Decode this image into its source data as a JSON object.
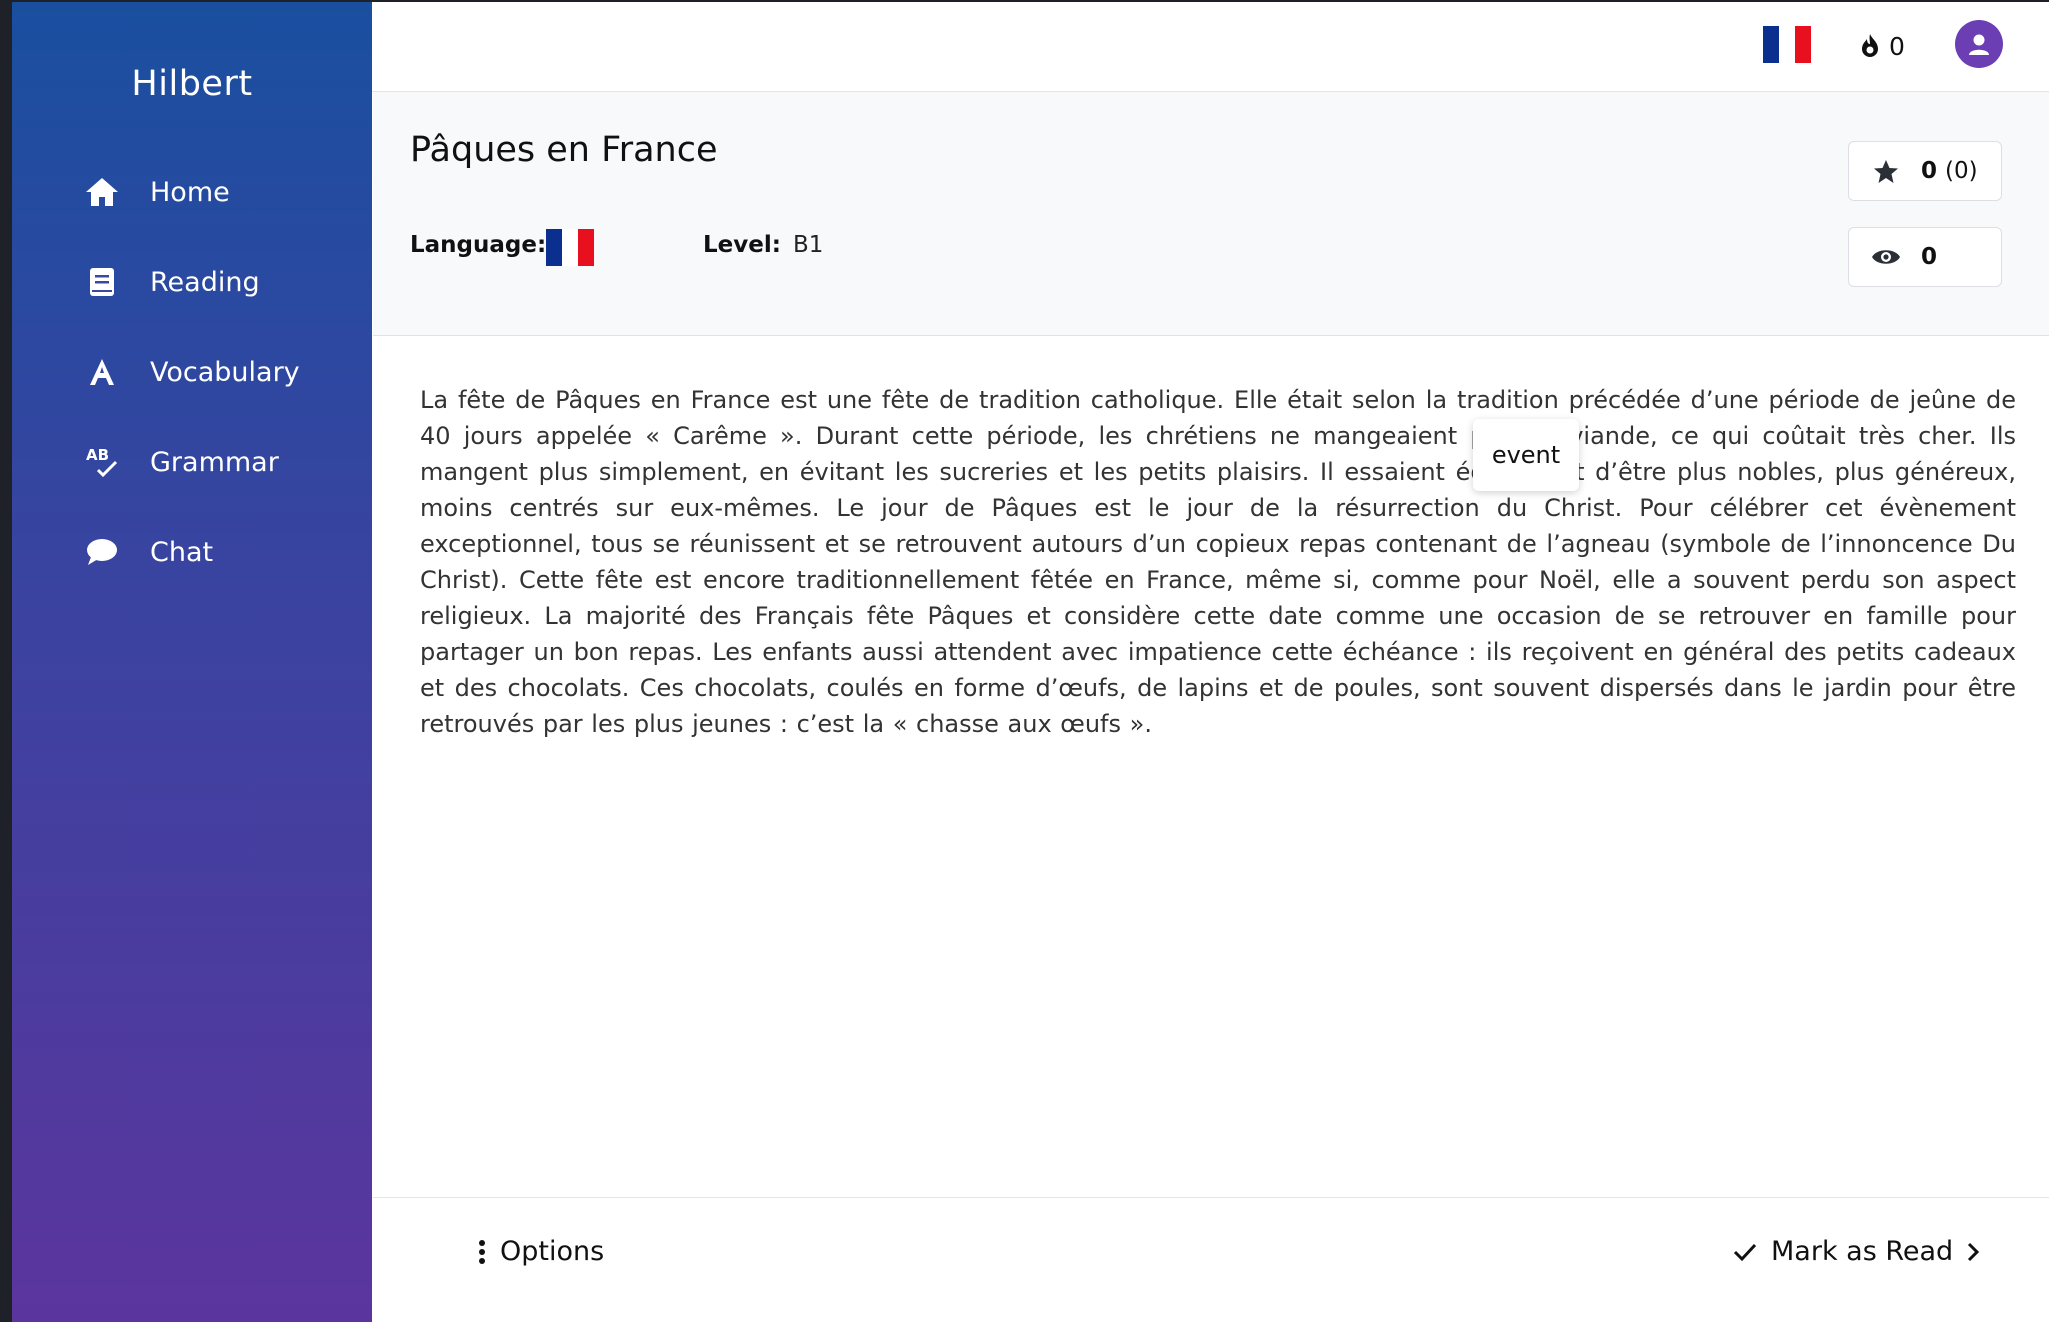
{
  "app": {
    "brand": "Hilbert"
  },
  "sidebar": {
    "items": [
      {
        "label": "Home",
        "icon": "home-icon"
      },
      {
        "label": "Reading",
        "icon": "book-icon"
      },
      {
        "label": "Vocabulary",
        "icon": "letter-a-icon"
      },
      {
        "label": "Grammar",
        "icon": "spellcheck-icon"
      },
      {
        "label": "Chat",
        "icon": "chat-bubble-icon"
      }
    ]
  },
  "topbar": {
    "streak_count": "0",
    "flag_icon": "french-flag-icon",
    "avatar_icon": "user-icon"
  },
  "article": {
    "title": "Pâques en France",
    "language_label": "Language:",
    "level_label": "Level:",
    "level_value": "B1",
    "rating_value": "0",
    "rating_count": "(0)",
    "views_value": "0",
    "body": "La fête de Pâques en France est une fête de tradition catholique. Elle était selon la tradition précédée d’une période de jeûne de 40 jours appelée « Carême ». Durant cette période, les chrétiens ne mangeaient pas de viande, ce qui coûtait très cher. Ils mangent plus simplement, en évitant les sucreries et les petits plaisirs. Il essaient également d’être plus nobles, plus généreux, moins centrés sur eux-mêmes. Le jour de Pâques est le jour de la résurrection du Christ. Pour célébrer cet évènement exceptionnel, tous se réunissent et se retrouvent autours d’un copieux repas contenant de l’agneau (symbole de l’innoncence Du Christ). Cette fête est encore traditionnellement fêtée en France, même si, comme pour Noël, elle a souvent perdu son aspect religieux. La majorité des Français fête Pâques et considère cette date comme une occasion de se retrouver en famille pour partager un bon repas. Les enfants aussi attendent avec impatience cette échéance : ils reçoivent en général des petits cadeaux et des chocolats. Ces chocolats, coulés en forme d’œufs, de lapins et de poules, sont souvent dispersés dans le jardin pour être retrouvés par les plus jeunes : c’est la « chasse aux œufs »."
  },
  "tooltip": {
    "text": "event"
  },
  "footer": {
    "options_label": "Options",
    "mark_read_label": "Mark as Read"
  },
  "colors": {
    "flag_blue": "#0b2f8f",
    "flag_red": "#e8101e",
    "avatar": "#6b3fb3"
  }
}
